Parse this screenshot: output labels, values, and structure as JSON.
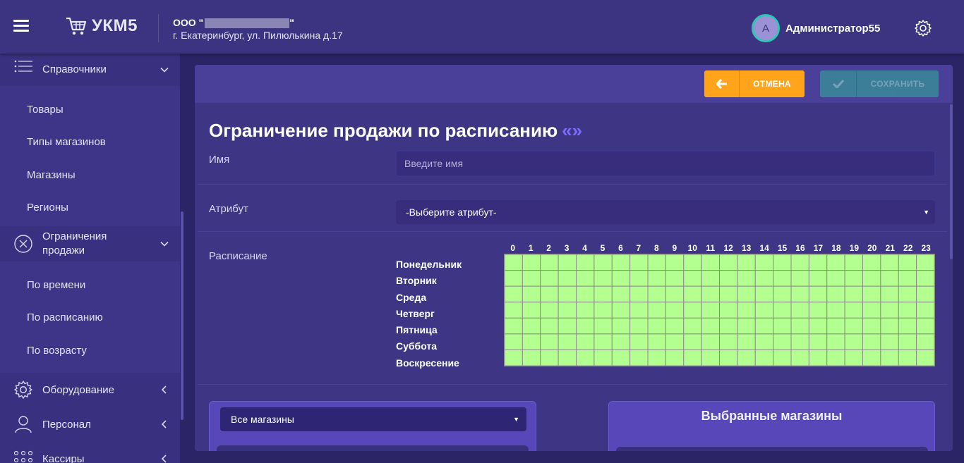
{
  "header": {
    "logo_text": "УКМ5",
    "company_prefix": "ООО \"",
    "company_suffix": "\"",
    "address": "г. Екатеринбург, ул. Пилюлькина д.17",
    "avatar_letter": "А",
    "username": "Администратор55"
  },
  "sidebar": {
    "directories": "Справочники",
    "directory_items": [
      "Товары",
      "Типы магазинов",
      "Магазины",
      "Регионы"
    ],
    "restrictions": "Ограничения продажи",
    "restriction_items": [
      "По времени",
      "По расписанию",
      "По возрасту"
    ],
    "equipment": "Оборудование",
    "staff": "Персонал",
    "cashiers": "Кассиры"
  },
  "toolbar": {
    "cancel_label": "ОТМЕНА",
    "save_label": "СОХРАНИТЬ"
  },
  "form": {
    "title": "Ограничение продажи по расписанию",
    "title_quotes": "«»",
    "name_label": "Имя",
    "name_placeholder": "Введите имя",
    "name_value": "",
    "attribute_label": "Атрибут",
    "attribute_value": "-Выберите атрибут-",
    "schedule_label": "Расписание"
  },
  "schedule": {
    "hours": [
      "0",
      "1",
      "2",
      "3",
      "4",
      "5",
      "6",
      "7",
      "8",
      "9",
      "10",
      "11",
      "12",
      "13",
      "14",
      "15",
      "16",
      "17",
      "18",
      "19",
      "20",
      "21",
      "22",
      "23"
    ],
    "days": [
      "Понедельник",
      "Вторник",
      "Среда",
      "Четверг",
      "Пятница",
      "Суббота",
      "Воскресение"
    ],
    "cell_color": "#b3ff8f"
  },
  "shops": {
    "filter_value": "Все магазины",
    "selected_title": "Выбранные магазины"
  },
  "colors": {
    "accent_orange": "#ffa41b",
    "accent_teal": "#3a8a98",
    "header_bg": "#3c3480",
    "avatar_ring": "#2ec7b5"
  }
}
